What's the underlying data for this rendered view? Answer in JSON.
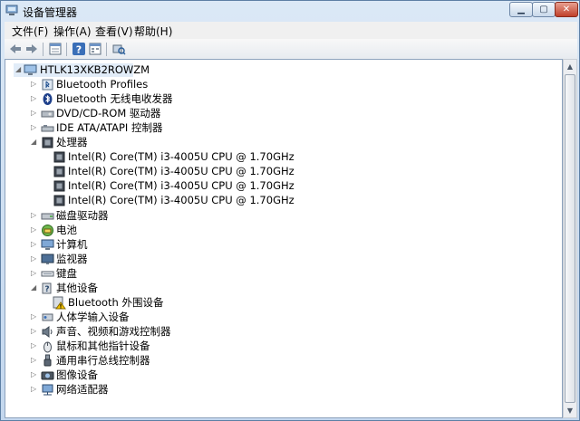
{
  "window": {
    "title": "设备管理器"
  },
  "menu": [
    "文件(F)",
    "操作(A)",
    "查看(V)",
    "帮助(H)"
  ],
  "toolbar": [
    "back-icon",
    "forward-icon",
    "properties-grid-icon",
    "help-icon",
    "view-grid-icon",
    "scan-hardware-icon"
  ],
  "tree": {
    "root": "HTLK13XKB2ROWZM",
    "categories": [
      {
        "label": "Bluetooth Profiles",
        "icon": "bluetooth-profiles-icon",
        "expanded": false
      },
      {
        "label": "Bluetooth 无线电收发器",
        "icon": "bluetooth-icon",
        "expanded": false
      },
      {
        "label": "DVD/CD-ROM 驱动器",
        "icon": "dvd-drive-icon",
        "expanded": false
      },
      {
        "label": "IDE ATA/ATAPI 控制器",
        "icon": "ide-controller-icon",
        "expanded": false
      },
      {
        "label": "处理器",
        "icon": "processor-icon",
        "expanded": true,
        "children": [
          "Intel(R) Core(TM) i3-4005U CPU @ 1.70GHz",
          "Intel(R) Core(TM) i3-4005U CPU @ 1.70GHz",
          "Intel(R) Core(TM) i3-4005U CPU @ 1.70GHz",
          "Intel(R) Core(TM) i3-4005U CPU @ 1.70GHz"
        ]
      },
      {
        "label": "磁盘驱动器",
        "icon": "disk-drive-icon",
        "expanded": false
      },
      {
        "label": "电池",
        "icon": "battery-icon",
        "expanded": false
      },
      {
        "label": "计算机",
        "icon": "computer-icon",
        "expanded": false
      },
      {
        "label": "监视器",
        "icon": "monitor-icon",
        "expanded": false
      },
      {
        "label": "键盘",
        "icon": "keyboard-icon",
        "expanded": false
      },
      {
        "label": "其他设备",
        "icon": "other-devices-icon",
        "expanded": true,
        "children": [
          "Bluetooth 外围设备"
        ]
      },
      {
        "label": "人体学输入设备",
        "icon": "hid-icon",
        "expanded": false
      },
      {
        "label": "声音、视频和游戏控制器",
        "icon": "sound-icon",
        "expanded": false
      },
      {
        "label": "鼠标和其他指针设备",
        "icon": "mouse-icon",
        "expanded": false
      },
      {
        "label": "通用串行总线控制器",
        "icon": "usb-icon",
        "expanded": false
      },
      {
        "label": "图像设备",
        "icon": "imaging-icon",
        "expanded": false
      },
      {
        "label": "网络适配器",
        "icon": "network-adapter-icon",
        "expanded": false
      }
    ]
  }
}
